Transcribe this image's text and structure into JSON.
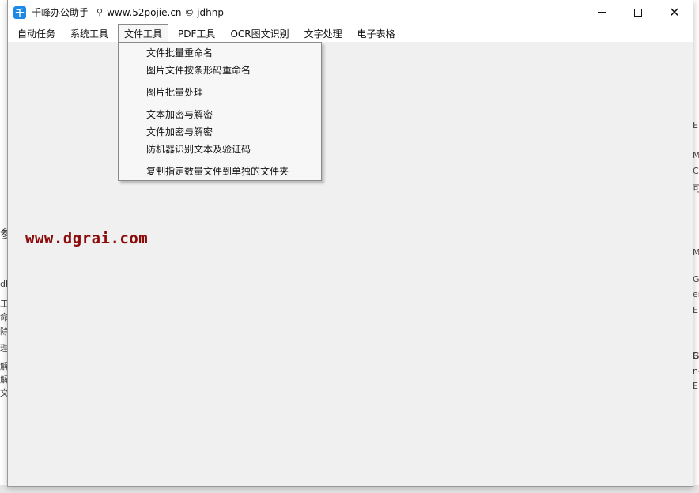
{
  "window": {
    "title": "千峰办公助手",
    "subtitle": "www.52pojie.cn © jdhnp",
    "icon_glyph": "千",
    "controls": {
      "minimize": "minimize",
      "maximize": "maximize",
      "close": "✕"
    }
  },
  "menubar": {
    "items": [
      "自动任务",
      "系统工具",
      "文件工具",
      "PDF工具",
      "OCR图文识别",
      "文字处理",
      "电子表格"
    ],
    "active": "文件工具"
  },
  "dropdown": {
    "items": [
      "文件批量重命名",
      "图片文件按条形码重命名",
      "图片批量处理",
      "文本加密与解密",
      "文件加密与解密",
      "防机器识别文本及验证码",
      "复制指定数量文件到单独的文件夹"
    ]
  },
  "watermark": "www.dgrai.com",
  "background_fragments": {
    "left": [
      "参",
      "dh",
      "工",
      "命",
      "除",
      "理",
      "解",
      "解",
      "文"
    ],
    "right": [
      "E",
      "M",
      "C",
      "可",
      "G",
      "M",
      "G",
      "en",
      "E",
      "B",
      "ng",
      "E"
    ]
  },
  "colors": {
    "accent_icon": "#1e88e5",
    "watermark": "#8b0a0a",
    "client_bg": "#f0f0f0"
  }
}
